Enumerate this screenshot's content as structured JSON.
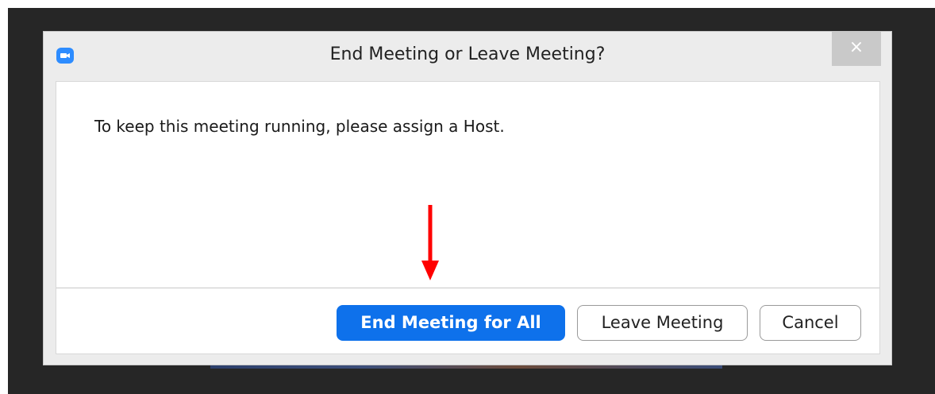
{
  "dialog": {
    "title": "End Meeting or Leave Meeting?",
    "app_icon": "zoom-camera-icon",
    "close_label": "×",
    "message": "To keep this meeting running, please assign a Host.",
    "buttons": {
      "end_all": "End Meeting for All",
      "leave": "Leave Meeting",
      "cancel": "Cancel"
    }
  },
  "annotation": {
    "icon": "red-arrow-down-icon",
    "color": "#ff0000"
  },
  "colors": {
    "primary": "#0e71eb",
    "app_icon": "#2d8cff"
  }
}
